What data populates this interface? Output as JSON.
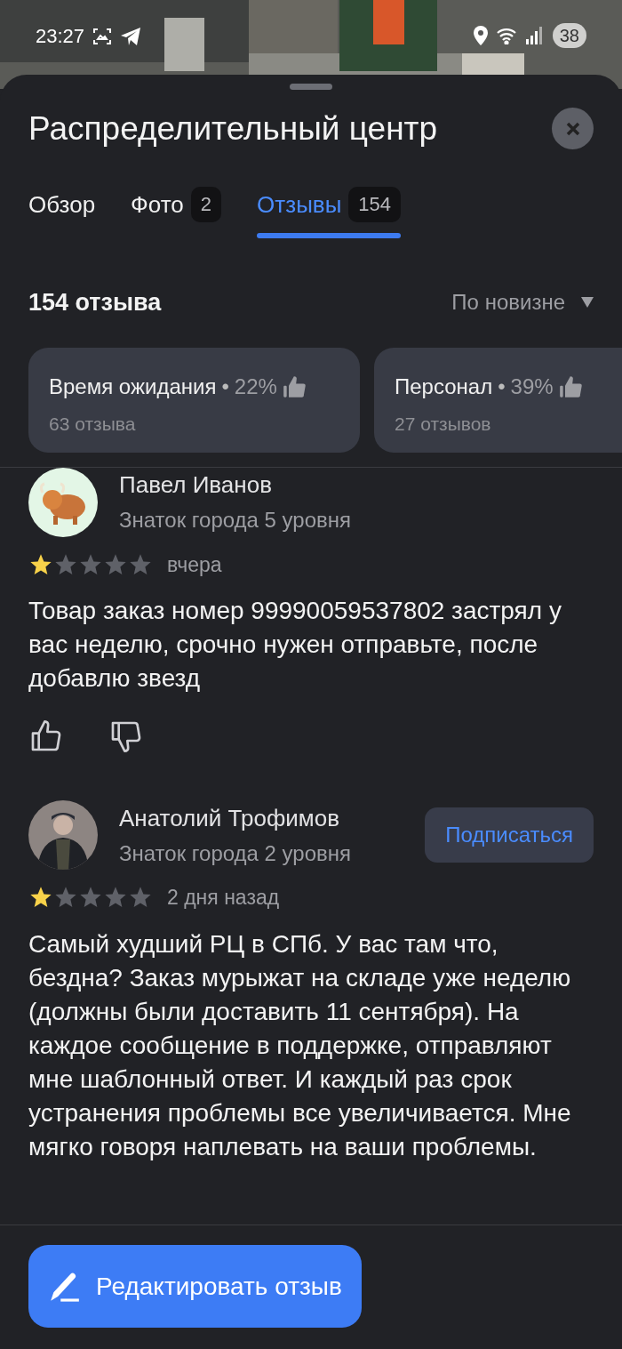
{
  "status_bar": {
    "time": "23:27",
    "battery": "38"
  },
  "title": "Распределительный центр",
  "tabs": [
    {
      "label": "Обзор",
      "selected": false
    },
    {
      "label": "Фото",
      "count": "2",
      "selected": false
    },
    {
      "label": "Отзывы",
      "count": "154",
      "selected": true
    }
  ],
  "reviews_count": "154 отзыва",
  "sort": "По новизне",
  "aspects": [
    {
      "name": "Время ожидания",
      "separator": "•",
      "percent": "22%",
      "count": "63 отзыва"
    },
    {
      "name": "Персонал",
      "separator": "•",
      "percent": "39%",
      "count": "27 отзывов"
    }
  ],
  "reviews": [
    {
      "author": "Павел Иванов",
      "level": "Знаток города 5 уровня",
      "kind": "animal",
      "stars": 1,
      "date": "вчера",
      "text": "Товар заказ номер 99990059537802 застрял у вас неделю, срочно нужен отправьте, после добавлю звезд",
      "reactions": true
    },
    {
      "author": "Анатолий Трофимов",
      "level": "Знаток города 2 уровня",
      "kind": "person",
      "stars": 1,
      "date": "2 дня назад",
      "subscribe": "Подписаться",
      "text": "Самый худший РЦ в СПб. У вас там что, бездна? Заказ мурыжат на складе уже неделю (должны были доставить 11 сентября). На каждое сообщение в поддержке, отправляют мне шаблонный ответ. И каждый раз срок устранения проблемы все увеличивается. Мне мягко говоря наплевать на ваши проблемы."
    }
  ],
  "edit_button": "Редактировать отзыв"
}
